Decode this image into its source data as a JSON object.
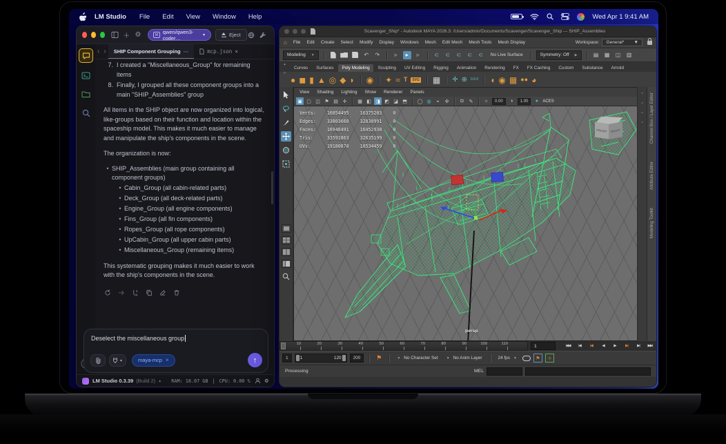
{
  "menu_bar": {
    "app_name": "LM Studio",
    "menus": [
      "File",
      "Edit",
      "View",
      "Window",
      "Help"
    ],
    "clock": "Wed Apr 1  9:41 AM"
  },
  "lm": {
    "model": "qwen/qwen3-coder…",
    "eject": "Eject",
    "nav_back": "‹",
    "nav_fwd": "›",
    "tab_active": "SHIP Component Grouping",
    "tab_more": "⋯",
    "tab_secondary": "mcp.json",
    "chat": {
      "item7_num": "7.",
      "item7": "I created a \"Miscellaneous_Group\" for remaining items",
      "item8_num": "8.",
      "item8": "Finally, I grouped all these component groups into a main \"SHIP_Assemblies\" group",
      "para1": "All items in the SHIP object are now organized into logical, like-groups based on their function and location within the spaceship model. This makes it much easier to manage and manipulate the ship's components in the scene.",
      "para2": "The organization is now:",
      "bullet_main": "SHIP_Assemblies (main group containing all component groups)",
      "bullets": [
        "Cabin_Group (all cabin-related parts)",
        "Deck_Group (all deck-related parts)",
        "Engine_Group (all engine components)",
        "Fins_Group (all fin components)",
        "Ropes_Group (all rope components)",
        "UpCabin_Group (all upper cabin parts)",
        "Miscellaneous_Group (remaining items)"
      ],
      "para3": "This systematic grouping makes it much easier to work with the ship's components in the scene."
    },
    "composer": {
      "value": "Deselect the miscellaneous group",
      "chip": "maya-mcp",
      "chip_close": "×"
    },
    "status": {
      "app": "LM Studio 0.3.39",
      "build": "(Build 2)",
      "ram": "RAM: 18.07 GB",
      "sep": "|",
      "cpu": "CPU: 0.00 %"
    }
  },
  "maya": {
    "title": "Scavenger_Ship* - Autodesk MAYA 2026.3: /Users/admin/Documents/Scavenger/Scavenger_Ship --- SHIP_Assemblies",
    "menus": [
      "File",
      "Edit",
      "Create",
      "Select",
      "Modify",
      "Display",
      "Windows",
      "Mesh",
      "Edit Mesh",
      "Mesh Tools",
      "Mesh Display"
    ],
    "workspace_label": "Workspace:",
    "workspace": "General*",
    "mode": "Modeling",
    "live_surface": "No Live Surface",
    "symmetry": "Symmetry: Off",
    "shelf_tabs": [
      "Curves",
      "Surfaces",
      "Poly Modeling",
      "Sculpting",
      "UV Editing",
      "Rigging",
      "Animation",
      "Rendering",
      "FX",
      "FX Caching",
      "Custom",
      "Substance",
      "Arnold"
    ],
    "panel_menus": [
      "View",
      "Shading",
      "Lighting",
      "Show",
      "Renderer",
      "Panels"
    ],
    "exposure": "0.00",
    "gamma": "1.00",
    "colorspace": "ACES",
    "hud": {
      "rows": [
        {
          "label": "Verts:",
          "a": "16854495",
          "b": "16375203",
          "c": "0"
        },
        {
          "label": "Edges:",
          "a": "33803668",
          "b": "32830991",
          "c": "0"
        },
        {
          "label": "Faces:",
          "a": "16946491",
          "b": "16452938",
          "c": "0"
        },
        {
          "label": "Tris:",
          "a": "33591863",
          "b": "32635199",
          "c": "0"
        },
        {
          "label": "UVs:",
          "a": "19180870",
          "b": "18534459",
          "c": "0"
        }
      ]
    },
    "camera": "persp",
    "cube_front": "FRONT",
    "cube_right": "RIGHT",
    "side_tabs": [
      "Channel Box / Layer Editor",
      "Attribute Editor",
      "Modeling Toolkit"
    ],
    "ticks": [
      "10",
      "20",
      "30",
      "40",
      "50",
      "60",
      "70",
      "80",
      "90",
      "100",
      "110"
    ],
    "current_frame": "1",
    "range": {
      "start": "1",
      "play_start": "1",
      "play_end": "120",
      "end": "200",
      "charset": "No Character Set",
      "anim_layer": "No Anim Layer",
      "fps": "24 fps"
    },
    "helpline": "Processing",
    "mel_label": "MEL"
  }
}
